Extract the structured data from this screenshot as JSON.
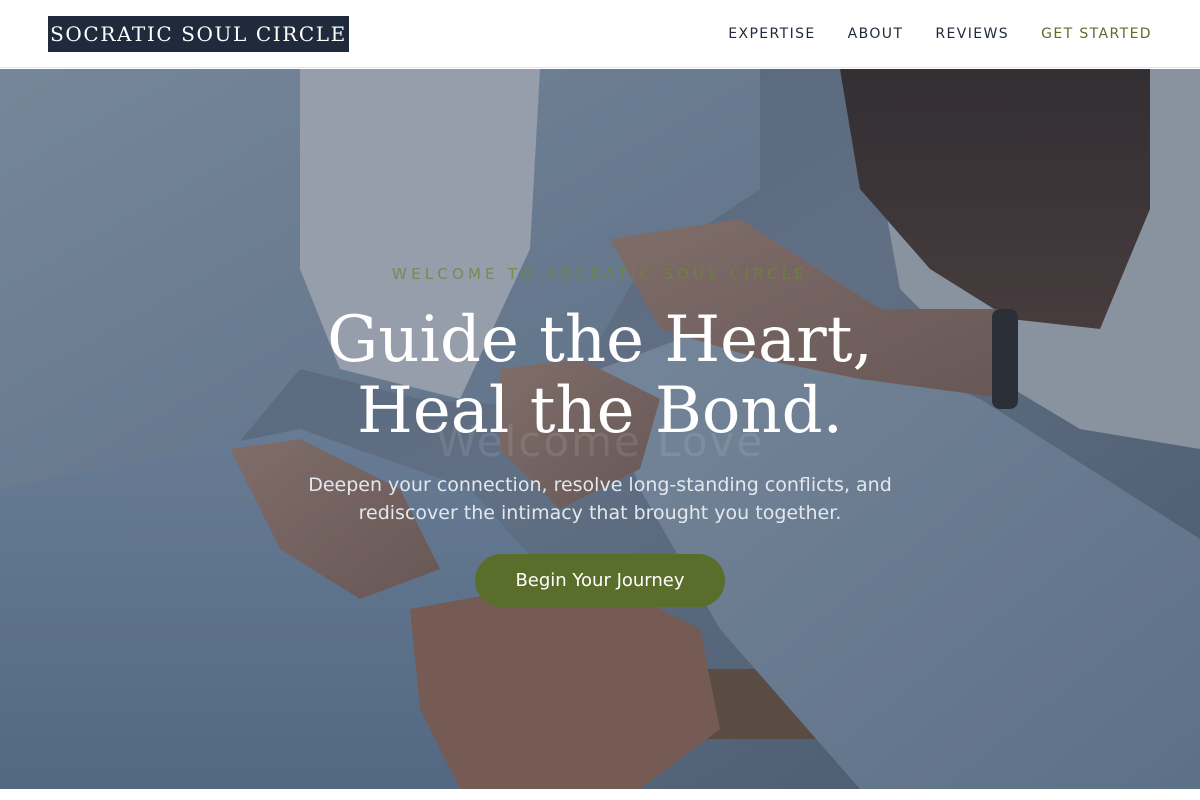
{
  "header": {
    "brand": "SOCRATIC SOUL CIRCLE",
    "nav": [
      {
        "label": "EXPERTISE"
      },
      {
        "label": "ABOUT"
      },
      {
        "label": "REVIEWS"
      },
      {
        "label": "GET STARTED"
      }
    ]
  },
  "hero": {
    "eyebrow": "WELCOME TO SOCRATIC SOUL CIRCLE",
    "ghost_text": "Welcome Love",
    "headline_line1": "Guide the Heart,",
    "headline_line2": "Heal the Bond.",
    "subtext": "Deepen your connection, resolve long-standing conflicts, and rediscover the intimacy that brought you together.",
    "cta_label": "Begin Your Journey"
  },
  "colors": {
    "brand_navy": "#1f2a3d",
    "accent_olive": "#5a6e2c",
    "nav_accent": "#5d6b2b",
    "overlay": "#283850"
  }
}
